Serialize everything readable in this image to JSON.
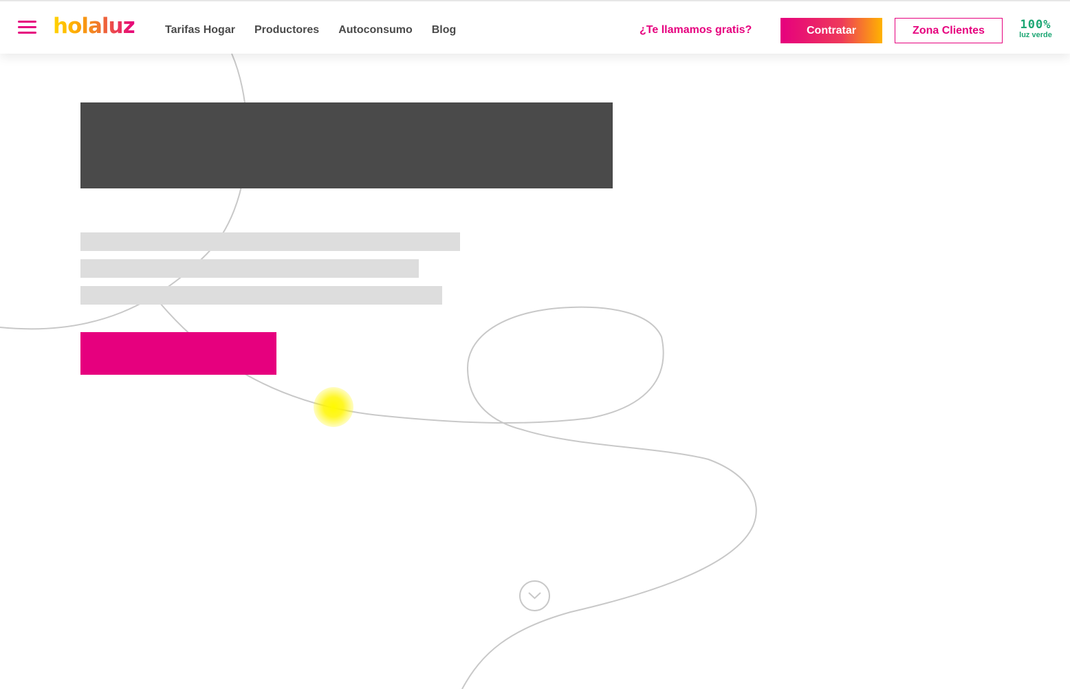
{
  "header": {
    "logo_text": "holaluz",
    "nav": [
      {
        "label": "Tarifas Hogar"
      },
      {
        "label": "Productores"
      },
      {
        "label": "Autoconsumo"
      },
      {
        "label": "Blog"
      }
    ],
    "callback_link": "¿Te llamamos gratis?",
    "contratar_label": "Contratar",
    "zona_clientes_label": "Zona Clientes",
    "badge": {
      "percent": "100%",
      "subtitle": "luz verde"
    }
  },
  "icons": {
    "menu": "hamburger-menu-icon",
    "scroll_down": "chevron-down-icon"
  },
  "colors": {
    "brand_pink": "#e6007e",
    "brand_yellow": "#ffd400",
    "brand_orange": "#ffb300",
    "badge_green": "#1ba673",
    "nav_text": "#4a4a4a",
    "title_placeholder": "#4a4a4a",
    "text_placeholder": "#dddddd",
    "curve_line": "#c8c8c8",
    "cursor_highlight": "#fff500"
  }
}
